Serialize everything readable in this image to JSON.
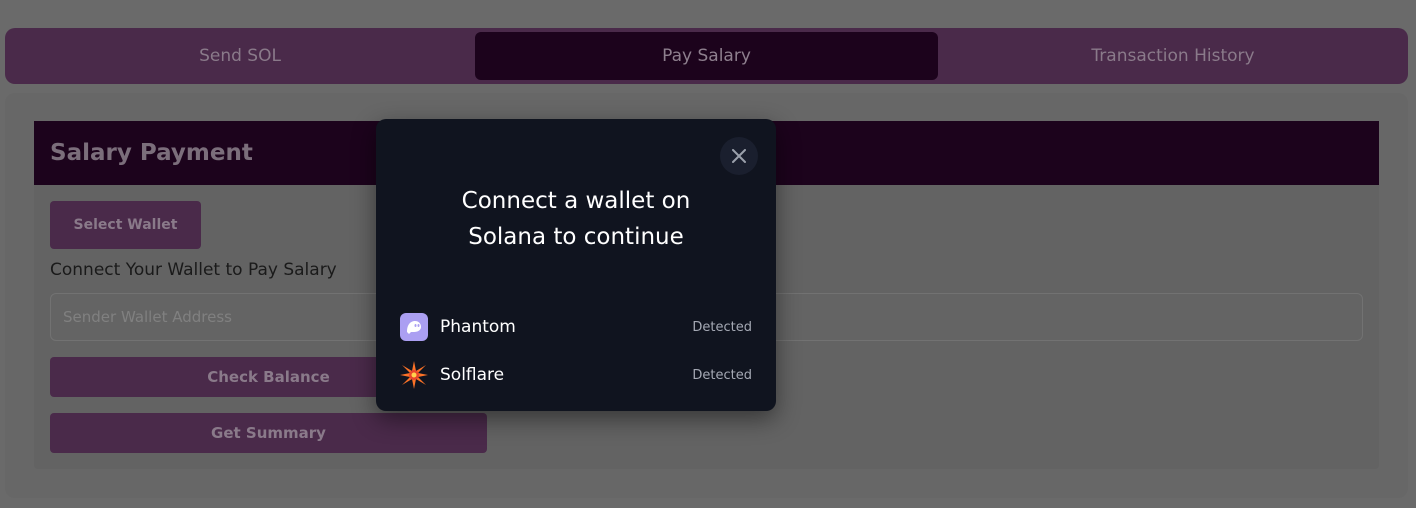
{
  "tabs": [
    "Send SOL",
    "Pay Salary",
    "Transaction History"
  ],
  "card": {
    "title": "Salary Payment",
    "select_wallet_label": "Select Wallet",
    "connect_label": "Connect Your Wallet to Pay Salary",
    "sender_placeholder": "Sender Wallet Address",
    "check_balance_label": "Check Balance",
    "get_summary_label": "Get Summary"
  },
  "modal": {
    "title_line1": "Connect a wallet on",
    "title_line2": "Solana to continue",
    "close_icon": "close-icon",
    "wallets": [
      {
        "name": "Phantom",
        "status": "Detected",
        "icon": "phantom-icon",
        "color": "#ab9ff2"
      },
      {
        "name": "Solflare",
        "status": "Detected",
        "icon": "solflare-icon",
        "color": "#fc7227"
      }
    ]
  },
  "colors": {
    "accent_dark": "#1c031c",
    "button_purple": "#4a2a4a",
    "modal_bg": "#10141f"
  }
}
